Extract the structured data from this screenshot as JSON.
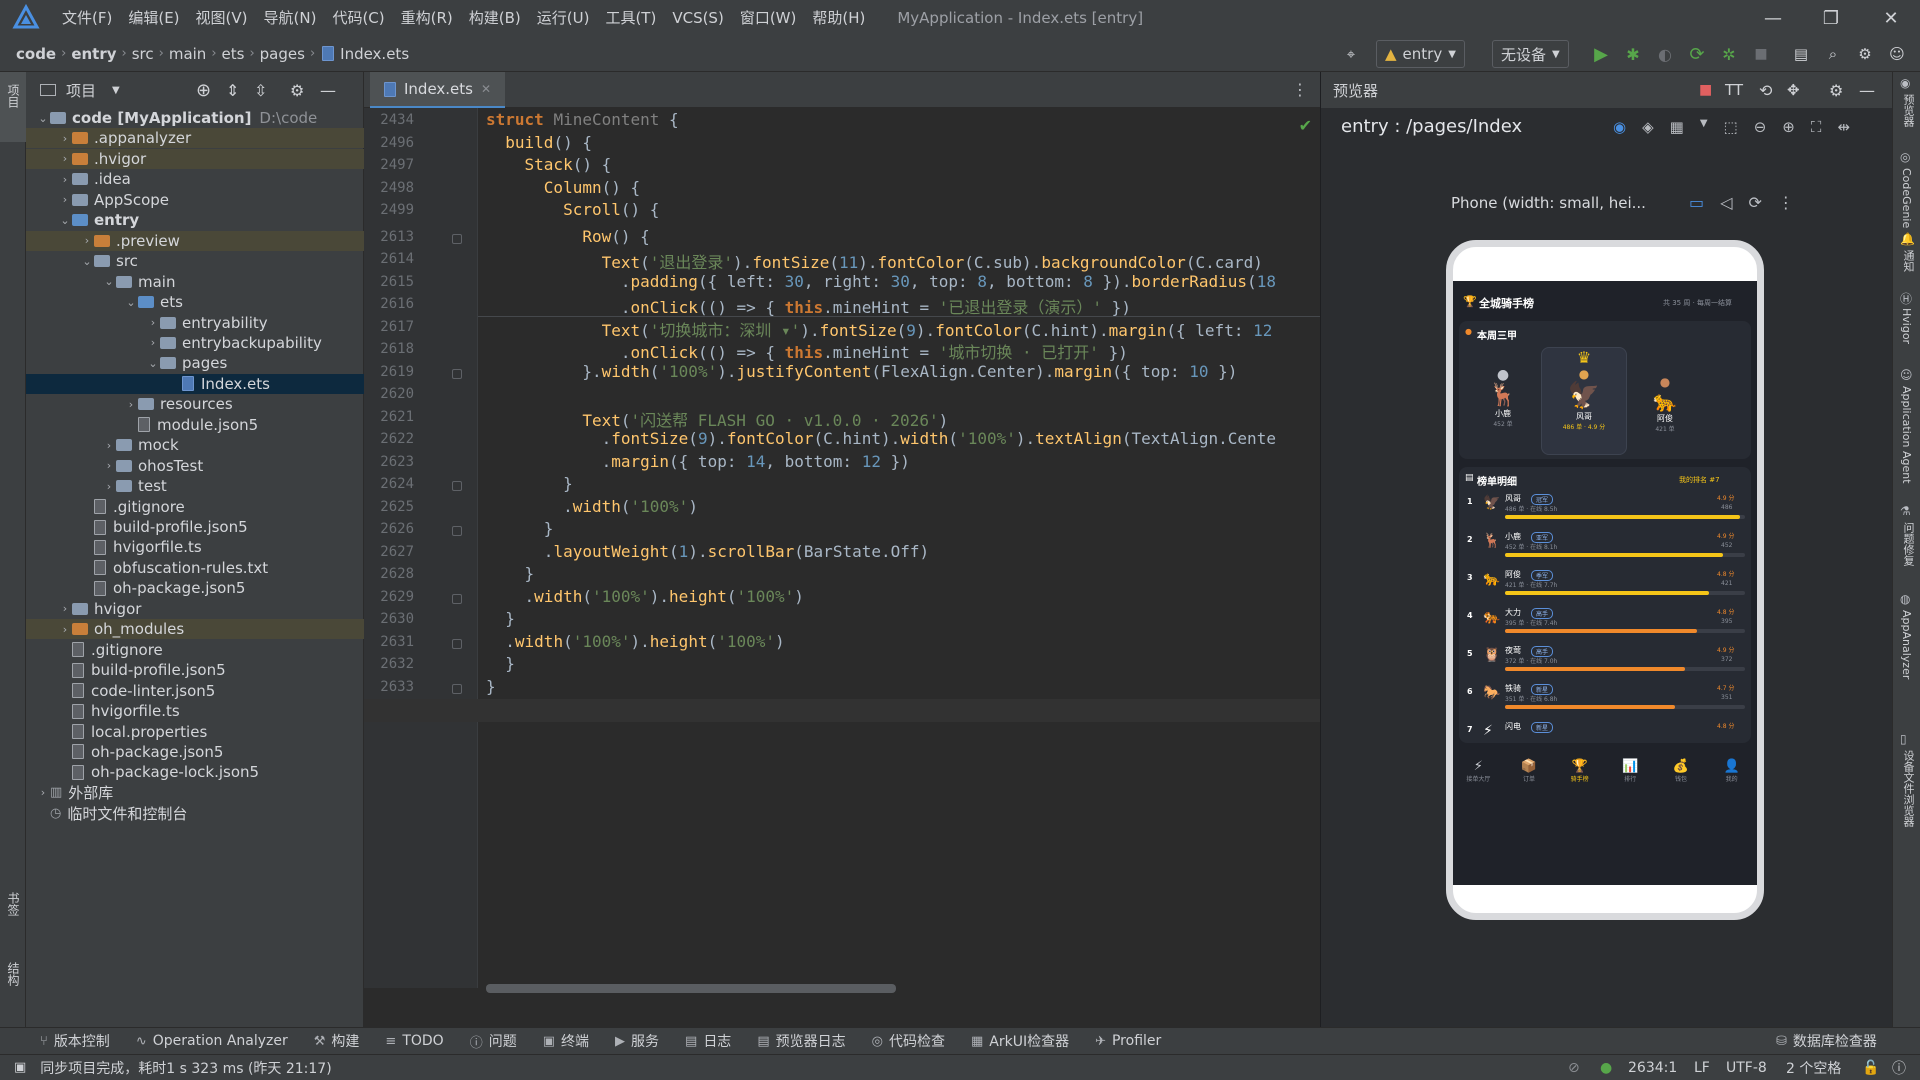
{
  "app": {
    "window_title": "MyApplication - Index.ets [entry]",
    "menu": [
      "文件(F)",
      "编辑(E)",
      "视图(V)",
      "导航(N)",
      "代码(C)",
      "重构(R)",
      "构建(B)",
      "运行(U)",
      "工具(T)",
      "VCS(S)",
      "窗口(W)",
      "帮助(H)"
    ]
  },
  "breadcrumb": [
    "code",
    "entry",
    "src",
    "main",
    "ets",
    "pages",
    "Index.ets"
  ],
  "toolbar": {
    "module": "entry",
    "device": "无设备"
  },
  "left_strip": {
    "top": "项目",
    "bottom1": "书签",
    "bottom2": "结构"
  },
  "project": {
    "title": "项目",
    "tree": [
      {
        "label": "code [MyApplication]",
        "extra": "D:\\code",
        "depth": 0,
        "arrow": "v",
        "icon": "folder",
        "bold": true
      },
      {
        "label": ".appanalyzer",
        "depth": 1,
        "arrow": ">",
        "icon": "folder-orange",
        "hl": true
      },
      {
        "label": ".hvigor",
        "depth": 1,
        "arrow": ">",
        "icon": "folder-orange",
        "hl": true
      },
      {
        "label": ".idea",
        "depth": 1,
        "arrow": ">",
        "icon": "folder"
      },
      {
        "label": "AppScope",
        "depth": 1,
        "arrow": ">",
        "icon": "folder"
      },
      {
        "label": "entry",
        "depth": 1,
        "arrow": "v",
        "icon": "folder-blue",
        "bold": true
      },
      {
        "label": ".preview",
        "depth": 2,
        "arrow": ">",
        "icon": "folder-orange",
        "hl": true
      },
      {
        "label": "src",
        "depth": 2,
        "arrow": "v",
        "icon": "folder"
      },
      {
        "label": "main",
        "depth": 3,
        "arrow": "v",
        "icon": "folder"
      },
      {
        "label": "ets",
        "depth": 4,
        "arrow": "v",
        "icon": "folder-blue"
      },
      {
        "label": "entryability",
        "depth": 5,
        "arrow": ">",
        "icon": "folder"
      },
      {
        "label": "entrybackupability",
        "depth": 5,
        "arrow": ">",
        "icon": "folder"
      },
      {
        "label": "pages",
        "depth": 5,
        "arrow": "v",
        "icon": "folder"
      },
      {
        "label": "Index.ets",
        "depth": 6,
        "arrow": "",
        "icon": "ets",
        "sel": true
      },
      {
        "label": "resources",
        "depth": 4,
        "arrow": ">",
        "icon": "folder"
      },
      {
        "label": "module.json5",
        "depth": 4,
        "arrow": "",
        "icon": "file"
      },
      {
        "label": "mock",
        "depth": 3,
        "arrow": ">",
        "icon": "folder"
      },
      {
        "label": "ohosTest",
        "depth": 3,
        "arrow": ">",
        "icon": "folder"
      },
      {
        "label": "test",
        "depth": 3,
        "arrow": ">",
        "icon": "folder"
      },
      {
        "label": ".gitignore",
        "depth": 2,
        "arrow": "",
        "icon": "file"
      },
      {
        "label": "build-profile.json5",
        "depth": 2,
        "arrow": "",
        "icon": "file"
      },
      {
        "label": "hvigorfile.ts",
        "depth": 2,
        "arrow": "",
        "icon": "file"
      },
      {
        "label": "obfuscation-rules.txt",
        "depth": 2,
        "arrow": "",
        "icon": "file"
      },
      {
        "label": "oh-package.json5",
        "depth": 2,
        "arrow": "",
        "icon": "file"
      },
      {
        "label": "hvigor",
        "depth": 1,
        "arrow": ">",
        "icon": "folder"
      },
      {
        "label": "oh_modules",
        "depth": 1,
        "arrow": ">",
        "icon": "folder-orange",
        "hl": true
      },
      {
        "label": ".gitignore",
        "depth": 1,
        "arrow": "",
        "icon": "file"
      },
      {
        "label": "build-profile.json5",
        "depth": 1,
        "arrow": "",
        "icon": "file"
      },
      {
        "label": "code-linter.json5",
        "depth": 1,
        "arrow": "",
        "icon": "file"
      },
      {
        "label": "hvigorfile.ts",
        "depth": 1,
        "arrow": "",
        "icon": "file"
      },
      {
        "label": "local.properties",
        "depth": 1,
        "arrow": "",
        "icon": "file"
      },
      {
        "label": "oh-package.json5",
        "depth": 1,
        "arrow": "",
        "icon": "file"
      },
      {
        "label": "oh-package-lock.json5",
        "depth": 1,
        "arrow": "",
        "icon": "file"
      },
      {
        "label": "外部库",
        "depth": 0,
        "arrow": ">",
        "icon": "lib"
      },
      {
        "label": "临时文件和控制台",
        "depth": 0,
        "arrow": "",
        "icon": "scratch"
      }
    ]
  },
  "editor": {
    "tab": "Index.ets",
    "lines": [
      {
        "n": "2434",
        "code": "<span class='kw'>struct</span> <span class='gray'>MineContent</span> {"
      },
      {
        "n": "2496",
        "code": "  <span class='fn'>build</span>() {"
      },
      {
        "n": "2497",
        "code": "    <span class='fn'>Stack</span>() {"
      },
      {
        "n": "2498",
        "code": "      <span class='fn'>Column</span>() {"
      },
      {
        "n": "2499",
        "code": "        <span class='fn'>Scroll</span>() {"
      },
      {
        "n": "2613",
        "code": "          <span class='fn'>Row</span>() {"
      },
      {
        "n": "2614",
        "code": "            <span class='fn'>Text</span>(<span class='str'>'退出登录'</span>).<span class='fn'>fontSize</span>(<span class='num'>11</span>).<span class='fn'>fontColor</span>(C.sub).<span class='fn'>backgroundColor</span>(C.card)"
      },
      {
        "n": "2615",
        "code": "              .<span class='fn'>padding</span>({ left: <span class='num'>30</span>, right: <span class='num'>30</span>, top: <span class='num'>8</span>, bottom: <span class='num'>8</span> }).<span class='fn'>borderRadius</span>(<span class='num'>18</span>"
      },
      {
        "n": "2616",
        "code": "              .<span class='fn'>onClick</span>(() => { <span class='kw'>this</span>.mineHint = <span class='str'>'已退出登录（演示）'</span> })"
      },
      {
        "n": "2617",
        "code": "            <span class='fn'>Text</span>(<span class='str'>'切换城市：深圳 ▾'</span>).<span class='fn'>fontSize</span>(<span class='num'>9</span>).<span class='fn'>fontColor</span>(C.hint).<span class='fn'>margin</span>({ left: <span class='num'>12</span>"
      },
      {
        "n": "2618",
        "code": "              .<span class='fn'>onClick</span>(() => { <span class='kw'>this</span>.mineHint = <span class='str'>'城市切换 · 已打开'</span> })"
      },
      {
        "n": "2619",
        "code": "          }.<span class='fn'>width</span>(<span class='str'>'100%'</span>).<span class='fn'>justifyContent</span>(FlexAlign.Center).<span class='fn'>margin</span>({ top: <span class='num'>10</span> })"
      },
      {
        "n": "2620",
        "code": ""
      },
      {
        "n": "2621",
        "code": "          <span class='fn'>Text</span>(<span class='str'>'闪送帮 FLASH GO · v1.0.0 · 2026'</span>)"
      },
      {
        "n": "2622",
        "code": "            .<span class='fn'>fontSize</span>(<span class='num'>9</span>).<span class='fn'>fontColor</span>(C.hint).<span class='fn'>width</span>(<span class='str'>'100%'</span>).<span class='fn'>textAlign</span>(TextAlign.Cente"
      },
      {
        "n": "2623",
        "code": "            .<span class='fn'>margin</span>({ top: <span class='num'>14</span>, bottom: <span class='num'>12</span> })"
      },
      {
        "n": "2624",
        "code": "        }"
      },
      {
        "n": "2625",
        "code": "        .<span class='fn'>width</span>(<span class='str'>'100%'</span>)"
      },
      {
        "n": "2626",
        "code": "      }"
      },
      {
        "n": "2627",
        "code": "      .<span class='fn'>layoutWeight</span>(<span class='num'>1</span>).<span class='fn'>scrollBar</span>(BarState.Off)"
      },
      {
        "n": "2628",
        "code": "    }"
      },
      {
        "n": "2629",
        "code": "    .<span class='fn'>width</span>(<span class='str'>'100%'</span>).<span class='fn'>height</span>(<span class='str'>'100%'</span>)"
      },
      {
        "n": "2630",
        "code": "  }"
      },
      {
        "n": "2631",
        "code": "  .<span class='fn'>width</span>(<span class='str'>'100%'</span>).<span class='fn'>height</span>(<span class='str'>'100%'</span>)"
      },
      {
        "n": "2632",
        "code": "  }"
      },
      {
        "n": "2633",
        "code": "}"
      },
      {
        "n": "2634",
        "code": ""
      }
    ]
  },
  "preview": {
    "title": "预览器",
    "route": "entry : /pages/Index",
    "device_label": "Phone (width: small, hei...",
    "phone": {
      "header": "全城骑手榜",
      "header_meta": "共 35 周 · 每周一结算",
      "podium_title": "本周三甲",
      "podium": [
        {
          "name": "小鹿",
          "sub": "452 单"
        },
        {
          "name": "风哥",
          "sub": "486 单 · 4.9 分"
        },
        {
          "name": "阿俊",
          "sub": "421 单"
        }
      ],
      "list_title": "榜单明细",
      "list_meta": "我的排名 #7",
      "rows": [
        {
          "rank": "1",
          "name": "风哥",
          "tag": "冠军",
          "sub": "486 单 · 在线 8.5h",
          "score": "4.9 分",
          "count": "486",
          "fill": 0.98,
          "color": "#f5c518"
        },
        {
          "rank": "2",
          "name": "小鹿",
          "tag": "亚军",
          "sub": "452 单 · 在线 8.1h",
          "score": "4.9 分",
          "count": "452",
          "fill": 0.91,
          "color": "#f5c518"
        },
        {
          "rank": "3",
          "name": "阿俊",
          "tag": "季军",
          "sub": "421 单 · 在线 7.7h",
          "score": "4.8 分",
          "count": "421",
          "fill": 0.85,
          "color": "#f5c518"
        },
        {
          "rank": "4",
          "name": "大力",
          "tag": "高手",
          "sub": "395 单 · 在线 7.4h",
          "score": "4.8 分",
          "count": "395",
          "fill": 0.8,
          "color": "#f0892b"
        },
        {
          "rank": "5",
          "name": "夜莺",
          "tag": "高手",
          "sub": "372 单 · 在线 7.0h",
          "score": "4.9 分",
          "count": "372",
          "fill": 0.75,
          "color": "#f0892b"
        },
        {
          "rank": "6",
          "name": "铁骑",
          "tag": "新星",
          "sub": "351 单 · 在线 6.8h",
          "score": "4.7 分",
          "count": "351",
          "fill": 0.71,
          "color": "#f0892b"
        },
        {
          "rank": "7",
          "name": "闪电",
          "tag": "新星",
          "sub": "",
          "score": "4.8 分",
          "count": "",
          "fill": 0,
          "color": "#f0892b"
        }
      ],
      "nav": [
        "接单大厅",
        "订单",
        "骑手榜",
        "排行",
        "钱包",
        "我的"
      ]
    }
  },
  "right_strip": [
    "预览器",
    "CodeGenie",
    "通知",
    "Hvigor",
    "Application Agent",
    "问题修复",
    "AppAnalyzer",
    "设备文件浏览器"
  ],
  "bottom_tools": [
    "版本控制",
    "Operation Analyzer",
    "构建",
    "TODO",
    "问题",
    "终端",
    "服务",
    "日志",
    "预览器日志",
    "代码检查",
    "ArkUI检查器",
    "Profiler"
  ],
  "bottom_right_tool": "数据库检查器",
  "status": {
    "message": "同步项目完成，耗时1 s 323 ms (昨天 21:17)",
    "position": "2634:1",
    "line_sep": "LF",
    "encoding": "UTF-8",
    "indent": "2 个空格"
  }
}
